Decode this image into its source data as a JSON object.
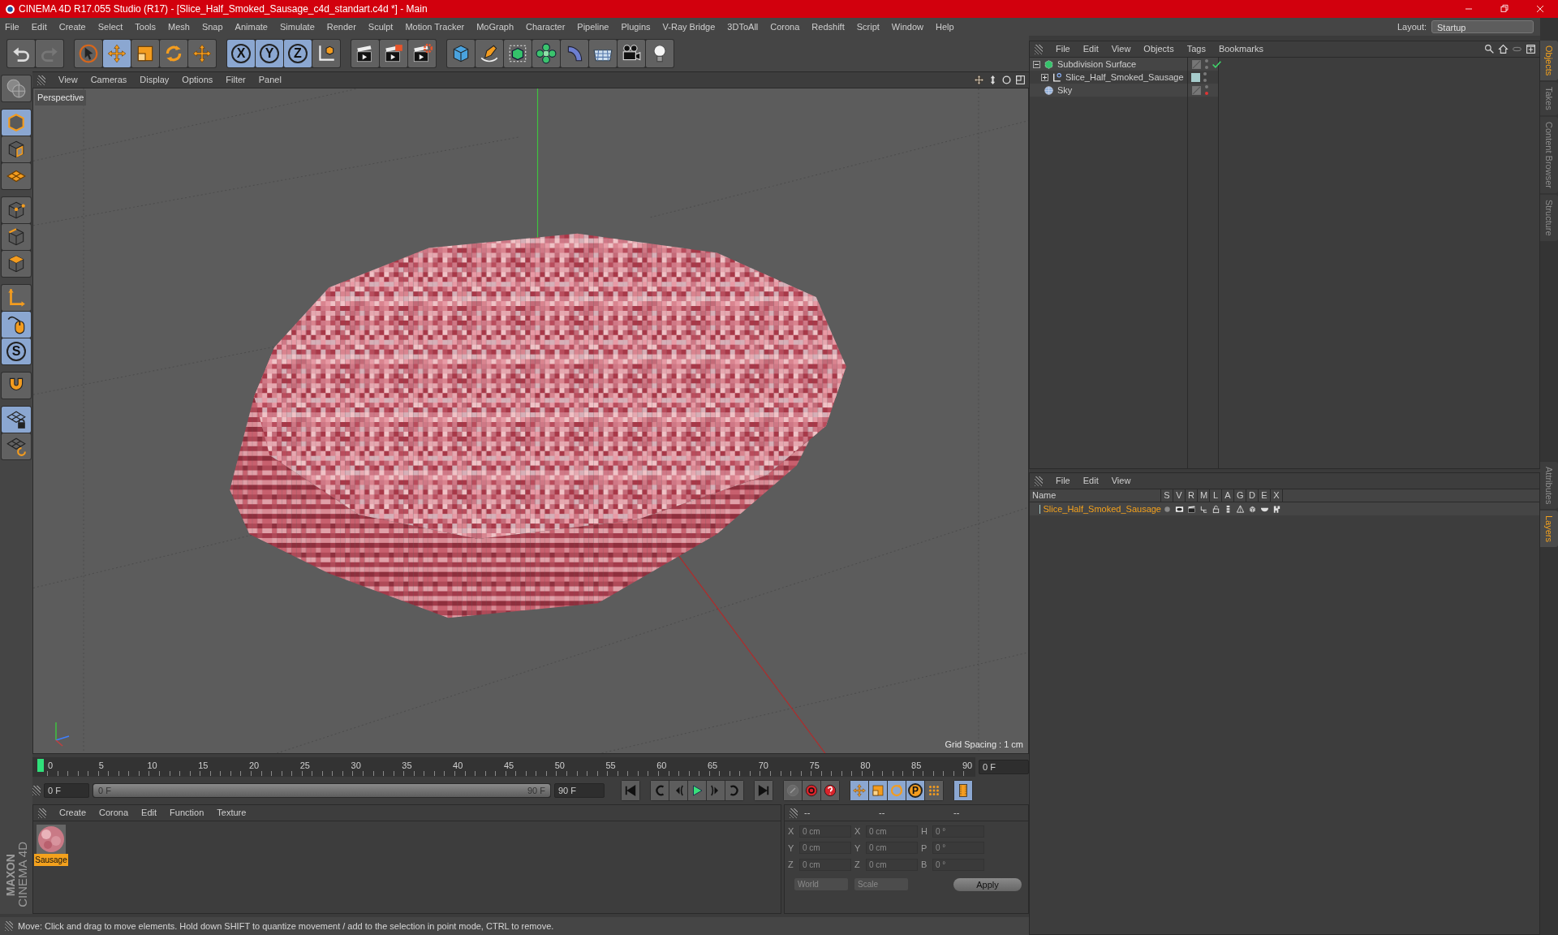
{
  "window": {
    "title": "CINEMA 4D R17.055 Studio (R17) - [Slice_Half_Smoked_Sausage_c4d_standart.c4d *] - Main"
  },
  "menu": [
    "File",
    "Edit",
    "Create",
    "Select",
    "Tools",
    "Mesh",
    "Snap",
    "Animate",
    "Simulate",
    "Render",
    "Sculpt",
    "Motion Tracker",
    "MoGraph",
    "Character",
    "Pipeline",
    "Plugins",
    "V-Ray Bridge",
    "3DToAll",
    "Corona",
    "Redshift",
    "Script",
    "Window",
    "Help"
  ],
  "layout": {
    "label": "Layout:",
    "value": "Startup"
  },
  "toolbar": [
    [
      {
        "kind": "undo",
        "selected": false
      },
      {
        "kind": "redo",
        "selected": false
      }
    ],
    [
      {
        "kind": "select",
        "selected": false
      },
      {
        "kind": "move",
        "selected": true
      },
      {
        "kind": "scale",
        "selected": false
      },
      {
        "kind": "rotate",
        "selected": false
      },
      {
        "kind": "transform",
        "selected": false
      }
    ],
    [
      {
        "kind": "axis",
        "label": "X",
        "selected": true
      },
      {
        "kind": "axis",
        "label": "Y",
        "selected": true
      },
      {
        "kind": "axis",
        "label": "Z",
        "selected": true
      },
      {
        "kind": "coord",
        "selected": false
      }
    ],
    [
      {
        "kind": "render_view",
        "selected": false
      },
      {
        "kind": "render",
        "selected": false
      },
      {
        "kind": "render_settings",
        "selected": false
      }
    ],
    [
      {
        "kind": "cube",
        "selected": false
      },
      {
        "kind": "pen",
        "selected": false
      },
      {
        "kind": "subdivision",
        "selected": false
      },
      {
        "kind": "cloner",
        "selected": false
      },
      {
        "kind": "deformer",
        "selected": false
      },
      {
        "kind": "floor",
        "selected": false
      },
      {
        "kind": "camera",
        "selected": false
      },
      {
        "kind": "light",
        "selected": false
      }
    ]
  ],
  "tools": [
    [
      {
        "kind": "globe",
        "selected": false
      }
    ],
    [
      {
        "kind": "model",
        "selected": true
      },
      {
        "kind": "texture",
        "selected": false
      },
      {
        "kind": "workplane",
        "selected": false
      }
    ],
    [
      {
        "kind": "points",
        "selected": false
      },
      {
        "kind": "edges",
        "selected": false
      },
      {
        "kind": "polygons",
        "selected": false
      }
    ],
    [
      {
        "kind": "axis_mode",
        "selected": false
      },
      {
        "kind": "tweak",
        "selected": true
      },
      {
        "kind": "solo",
        "label": "S",
        "selected": true
      }
    ],
    [
      {
        "kind": "magnet",
        "selected": false
      }
    ],
    [
      {
        "kind": "grid_lock",
        "selected": true
      },
      {
        "kind": "grid_rotate",
        "selected": false
      }
    ]
  ],
  "logo": [
    "MAXON",
    "CINEMA 4D"
  ],
  "viewport": {
    "menu": [
      "View",
      "Cameras",
      "Display",
      "Options",
      "Filter",
      "Panel"
    ],
    "camera": "Perspective",
    "grid_spacing": "Grid Spacing : 1 cm"
  },
  "timeline": {
    "ticks": [
      "0",
      "5",
      "10",
      "15",
      "20",
      "25",
      "30",
      "35",
      "40",
      "45",
      "50",
      "55",
      "60",
      "65",
      "70",
      "75",
      "80",
      "85",
      "90"
    ],
    "current_frame": "0 F",
    "start": "0 F",
    "range": {
      "start": "0 F",
      "end": "90 F",
      "level": 1
    },
    "end": "90 F",
    "controls": [
      [
        {
          "kind": "first",
          "selected": false
        }
      ],
      [
        {
          "kind": "prev_key",
          "selected": false
        },
        {
          "kind": "prev_frame",
          "selected": false
        },
        {
          "kind": "play",
          "selected": false
        },
        {
          "kind": "next_frame",
          "selected": false
        },
        {
          "kind": "next_key",
          "selected": false
        }
      ],
      [
        {
          "kind": "last",
          "selected": false
        }
      ],
      [
        {
          "kind": "key_off",
          "selected": false
        },
        {
          "kind": "record",
          "selected": false
        },
        {
          "kind": "autokey",
          "selected": false
        }
      ],
      [
        {
          "kind": "pos",
          "selected": true
        },
        {
          "kind": "scl",
          "selected": true
        },
        {
          "kind": "rot",
          "selected": true
        },
        {
          "kind": "param",
          "label": "P",
          "selected": true
        },
        {
          "kind": "pla",
          "selected": false
        }
      ],
      [
        {
          "kind": "film",
          "selected": true
        }
      ]
    ]
  },
  "materials": {
    "menu": [
      "Create",
      "Corona",
      "Edit",
      "Function",
      "Texture"
    ],
    "items": [
      {
        "name": "Sausage",
        "selected": true
      }
    ]
  },
  "coordinates": {
    "headers": [
      "--",
      "--",
      "--"
    ],
    "rows": [
      {
        "pos_label": "X",
        "pos_value": "0 cm",
        "size_label": "X",
        "size_value": "0 cm",
        "rot_label": "H",
        "rot_value": "0 °"
      },
      {
        "pos_label": "Y",
        "pos_value": "0 cm",
        "size_label": "Y",
        "size_value": "0 cm",
        "rot_label": "P",
        "rot_value": "0 °"
      },
      {
        "pos_label": "Z",
        "pos_value": "0 cm",
        "size_label": "Z",
        "size_value": "0 cm",
        "rot_label": "B",
        "rot_value": "0 °"
      }
    ],
    "modes": [
      "World",
      "Scale"
    ],
    "apply": "Apply"
  },
  "status_bar": "Move: Click and drag to move elements. Hold down SHIFT to quantize movement / add to the selection in point mode, CTRL to remove.",
  "objects": {
    "menu": [
      "File",
      "Edit",
      "View",
      "Objects",
      "Tags",
      "Bookmarks"
    ],
    "tree": [
      {
        "name": "Subdivision Surface",
        "kind": "subdivision",
        "expanded": true,
        "enabled": true,
        "render_off": false,
        "children": [
          {
            "name": "Slice_Half_Smoked_Sausage",
            "kind": "polygon",
            "expanded": false,
            "color": "#a6cccc",
            "render_off": false
          }
        ]
      },
      {
        "name": "Sky",
        "kind": "sky",
        "render_off": true
      }
    ]
  },
  "layers": {
    "menu": [
      "File",
      "Edit",
      "View"
    ],
    "columns": [
      "Name",
      "S",
      "V",
      "R",
      "M",
      "L",
      "A",
      "G",
      "D",
      "E",
      "X"
    ],
    "rows": [
      {
        "name": "Slice_Half_Smoked_Sausage",
        "color": "#a6cccc"
      }
    ]
  },
  "side_tabs_top": [
    {
      "label": "Objects",
      "selected": true
    },
    {
      "label": "Takes",
      "selected": false
    },
    {
      "label": "Content Browser",
      "selected": false
    },
    {
      "label": "Structure",
      "selected": false
    }
  ],
  "side_tabs_bottom": [
    {
      "label": "Attributes",
      "selected": false
    },
    {
      "label": "Layers",
      "selected": true
    }
  ]
}
